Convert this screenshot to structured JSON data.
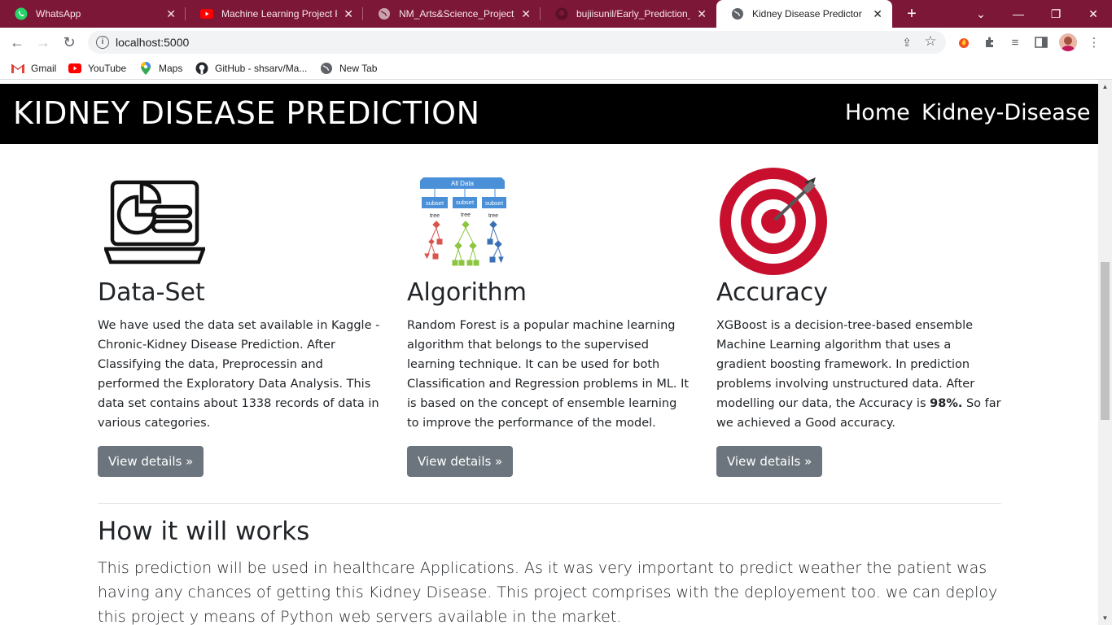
{
  "browser": {
    "tabs": [
      {
        "title": "WhatsApp",
        "favicon": "whatsapp-icon"
      },
      {
        "title": "Machine Learning Project Files",
        "favicon": "youtube-icon"
      },
      {
        "title": "NM_Arts&Science_Project_De",
        "favicon": "globe-icon"
      },
      {
        "title": "bujiisunil/Early_Prediction_fo",
        "favicon": "github-icon"
      },
      {
        "title": "Kidney Disease Predictor",
        "favicon": "globe-icon",
        "active": true
      }
    ],
    "url": "localhost:5000",
    "bookmarks": [
      {
        "label": "Gmail",
        "icon": "gmail-icon"
      },
      {
        "label": "YouTube",
        "icon": "youtube-icon"
      },
      {
        "label": "Maps",
        "icon": "maps-icon"
      },
      {
        "label": "GitHub - shsarv/Ma...",
        "icon": "github-icon"
      },
      {
        "label": "New Tab",
        "icon": "globe-icon"
      }
    ],
    "theme_color": "#7d1737"
  },
  "navbar": {
    "brand": "KIDNEY DISEASE PREDICTION",
    "links": [
      "Home",
      "Kidney-Disease"
    ]
  },
  "features": [
    {
      "icon": "laptop-chart-icon",
      "title": "Data-Set",
      "text": "We have used the data set available in Kaggle - Chronic-Kidney Disease Prediction. After Classifying the data, Preprocessin and performed the Exploratory Data Analysis. This data set contains about 1338 records of data in various categories.",
      "button": "View details »"
    },
    {
      "icon": "random-forest-icon",
      "title": "Algorithm",
      "text": "Random Forest is a popular machine learning algorithm that belongs to the supervised learning technique. It can be used for both Classification and Regression problems in ML. It is based on the concept of ensemble learning to improve the performance of the model.",
      "button": "View details »",
      "diagram": {
        "root": "All Data",
        "subset": "subset",
        "tree": "tree"
      }
    },
    {
      "icon": "target-icon",
      "title": "Accuracy",
      "text_before": "XGBoost is a decision-tree-based ensemble Machine Learning algorithm that uses a gradient boosting framework. In prediction problems involving unstructured data. After modelling our data, the Accuracy is",
      "text_bold": "98%.",
      "text_after": "So far we achieved a Good accuracy.",
      "button": "View details »"
    }
  ],
  "how": {
    "title": "How it will works",
    "text": "This prediction will be used in healthcare Applications. As it was very important to predict weather the patient was having any chances of getting this Kidney Disease. This project comprises with the deployement too. we can deploy this project y means of Python web servers available in the market."
  }
}
